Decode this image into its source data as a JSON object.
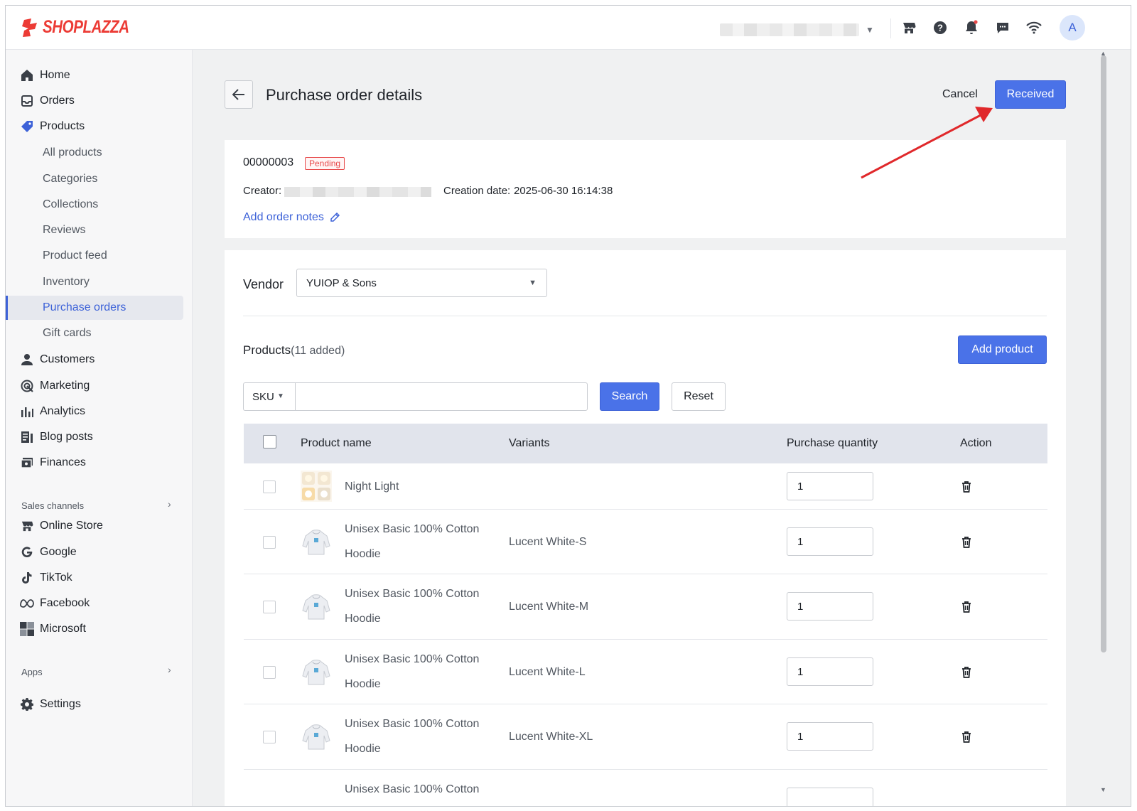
{
  "brand": {
    "name": "SHOPLAZZA",
    "color": "#ec3b35",
    "accent": "#4a72e8"
  },
  "topbar": {
    "icons": [
      "store-icon",
      "help-icon",
      "bell-icon",
      "chat-icon",
      "wifi-icon"
    ],
    "avatar_letter": "A"
  },
  "sidebar": {
    "items": [
      {
        "label": "Home",
        "icon": "home-icon"
      },
      {
        "label": "Orders",
        "icon": "orders-icon"
      },
      {
        "label": "Products",
        "icon": "tag-icon"
      }
    ],
    "product_subitems": [
      "All products",
      "Categories",
      "Collections",
      "Reviews",
      "Product feed",
      "Inventory",
      "Purchase orders",
      "Gift cards"
    ],
    "active_subitem": "Purchase orders",
    "items_after": [
      {
        "label": "Customers",
        "icon": "person-icon"
      },
      {
        "label": "Marketing",
        "icon": "marketing-icon"
      },
      {
        "label": "Analytics",
        "icon": "analytics-icon"
      },
      {
        "label": "Blog posts",
        "icon": "blog-icon"
      },
      {
        "label": "Finances",
        "icon": "finances-icon"
      }
    ],
    "sales_channels_label": "Sales channels",
    "channels": [
      {
        "label": "Online Store",
        "icon": "store-icon"
      },
      {
        "label": "Google",
        "icon": "google-icon"
      },
      {
        "label": "TikTok",
        "icon": "tiktok-icon"
      },
      {
        "label": "Facebook",
        "icon": "meta-icon"
      },
      {
        "label": "Microsoft",
        "icon": "microsoft-icon"
      }
    ],
    "apps_label": "Apps",
    "settings_label": "Settings"
  },
  "header": {
    "title": "Purchase order details",
    "cancel_label": "Cancel",
    "received_label": "Received"
  },
  "order": {
    "number": "00000003",
    "status": "Pending",
    "creator_label": "Creator:",
    "creation_date_label": "Creation date:",
    "creation_date": "2025-06-30 16:14:38",
    "add_notes_label": "Add order notes"
  },
  "vendor": {
    "label": "Vendor",
    "selected": "YUIOP & Sons"
  },
  "products": {
    "heading": "Products",
    "count": "11",
    "count_suffix": " added)",
    "add_label": "Add product",
    "filter_field": "SKU",
    "search_value": "",
    "search_label": "Search",
    "reset_label": "Reset"
  },
  "table": {
    "columns": [
      "Product name",
      "Variants",
      "Purchase quantity",
      "Action"
    ],
    "rows": [
      {
        "name": "Night Light",
        "variant": "",
        "qty": "1",
        "thumb": "night-light"
      },
      {
        "name": "Unisex Basic 100% Cotton Hoodie",
        "variant": "Lucent White-S",
        "qty": "1",
        "thumb": "hoodie"
      },
      {
        "name": "Unisex Basic 100% Cotton Hoodie",
        "variant": "Lucent White-M",
        "qty": "1",
        "thumb": "hoodie"
      },
      {
        "name": "Unisex Basic 100% Cotton Hoodie",
        "variant": "Lucent White-L",
        "qty": "1",
        "thumb": "hoodie"
      },
      {
        "name": "Unisex Basic 100% Cotton Hoodie",
        "variant": "Lucent White-XL",
        "qty": "1",
        "thumb": "hoodie"
      },
      {
        "name": "Unisex Basic 100% Cotton",
        "variant": "",
        "qty": "",
        "thumb": ""
      }
    ]
  }
}
